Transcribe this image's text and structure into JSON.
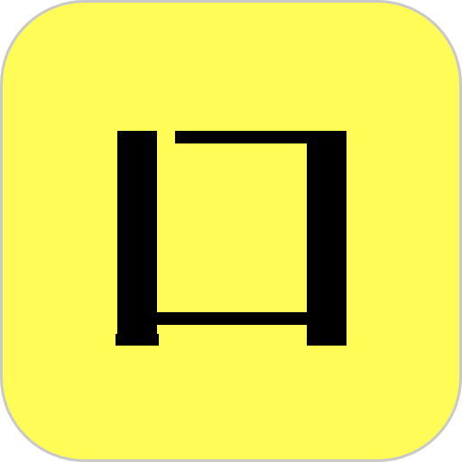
{
  "icon": {
    "name": "app-logo-icon",
    "background_color": "#FFFB57",
    "border_color": "#C9C9C9",
    "glyph_color": "#000000"
  }
}
